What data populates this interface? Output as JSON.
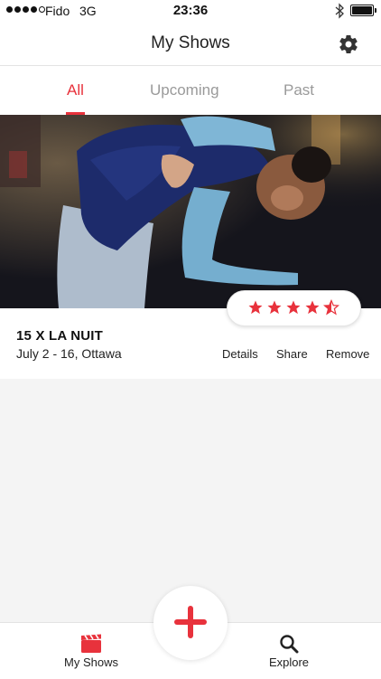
{
  "status_bar": {
    "carrier": "Fido",
    "network": "3G",
    "time": "23:36",
    "signal_bars_filled": 4,
    "signal_bars_total": 5
  },
  "header": {
    "title": "My Shows",
    "settings_icon": "gear-icon"
  },
  "tabs": [
    {
      "label": "All",
      "active": true
    },
    {
      "label": "Upcoming",
      "active": false
    },
    {
      "label": "Past",
      "active": false
    }
  ],
  "show": {
    "title": "15 X LA NUIT",
    "meta": "July 2 - 16, Ottawa",
    "rating_stars": 4.5,
    "rating_max": 5,
    "actions": {
      "details": "Details",
      "share": "Share",
      "remove": "Remove"
    }
  },
  "tab_bar": {
    "my_shows": {
      "label": "My Shows",
      "icon": "clapperboard-icon"
    },
    "explore": {
      "label": "Explore",
      "icon": "search-icon"
    },
    "add_icon": "plus-icon"
  },
  "colors": {
    "accent": "#e8323c",
    "inactive_tab": "#9a9a9a",
    "background": "#f4f4f4"
  }
}
